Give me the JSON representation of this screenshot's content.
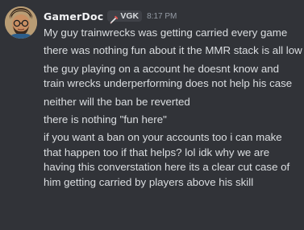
{
  "message": {
    "author": {
      "username": "GamerDoc",
      "avatar_icon": "cartoon-avatar-icon",
      "tag": {
        "icon": "pencil-sword-icon",
        "label": "VGK",
        "accent_color": "#e0524f"
      }
    },
    "timestamp": "8:17 PM",
    "lines": [
      "My guy trainwrecks was getting carried every game",
      "there was nothing fun about it the MMR stack is all low",
      "the guy playing on a account he doesnt know and train wrecks underperforming does not help his case",
      "neither will the ban be reverted",
      "there is nothing \"fun here\"",
      "if you want a ban on your accounts too i can make that happen too if that helps? lol idk why we are having this converstation here its a clear cut case of him getting carried by players above his skill"
    ]
  },
  "colors": {
    "background": "#313338",
    "text": "#dbdee1",
    "username": "#f2f3f5",
    "timestamp": "#949ba4",
    "tag_background": "#3f4147"
  }
}
